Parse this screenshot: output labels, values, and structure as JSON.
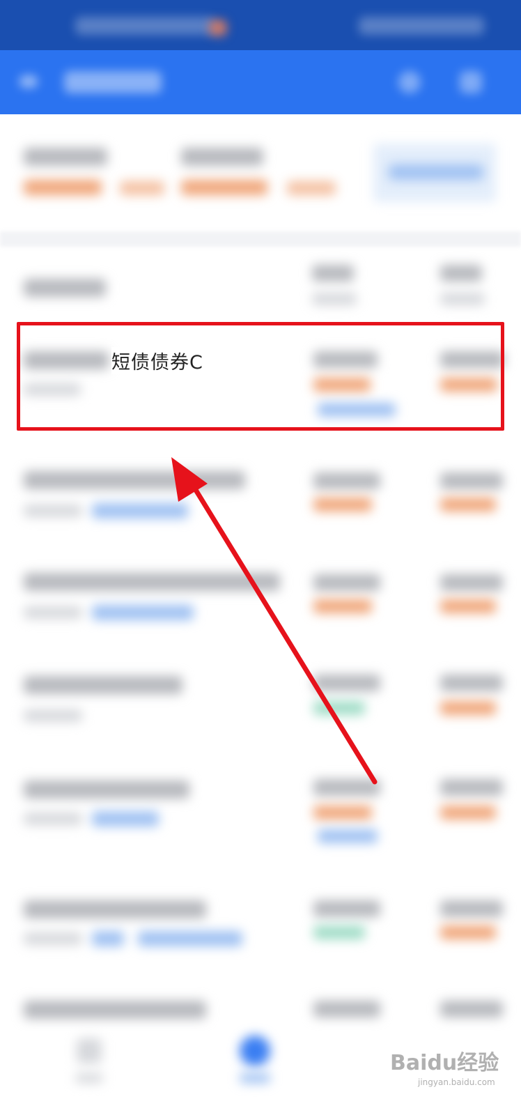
{
  "highlighted_fund": {
    "name_visible_part": "短债债券C"
  },
  "watermark": {
    "brand": "Baidu经验",
    "site": "jingyan.baidu.com"
  },
  "colors": {
    "status_bar": "#1a4fb0",
    "app_bar": "#2b73f0",
    "highlight": "#e6121b",
    "accent": "#2b73f0"
  },
  "icons": {
    "back": "back-arrow-icon",
    "search": "search-icon",
    "menu": "menu-icon"
  }
}
